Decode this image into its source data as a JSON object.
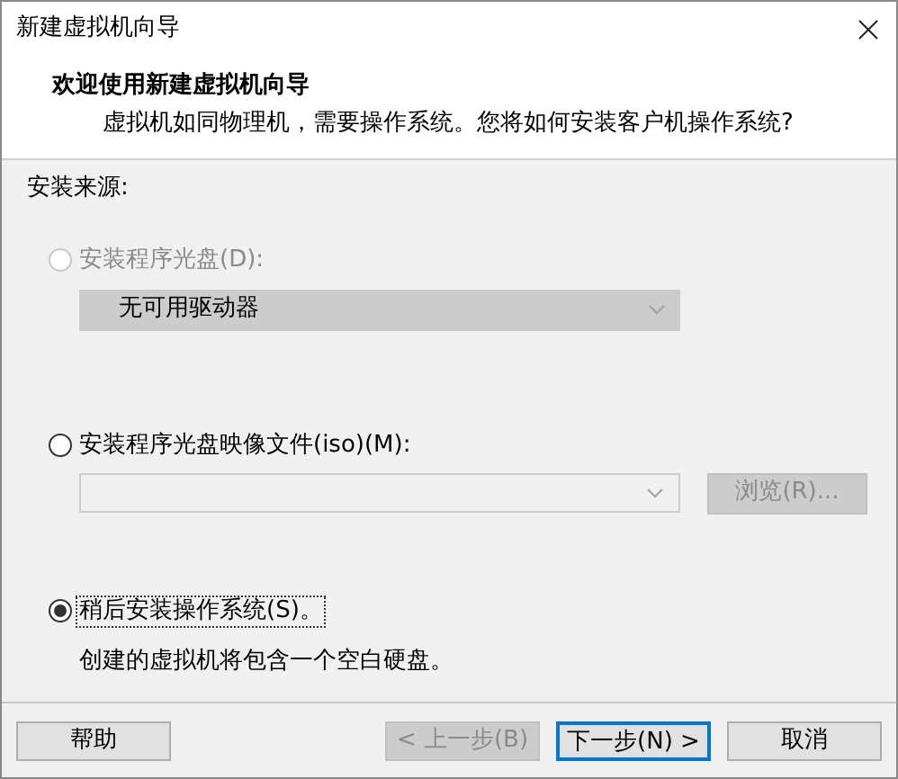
{
  "window": {
    "title": "新建虚拟机向导"
  },
  "header": {
    "title": "欢迎使用新建虚拟机向导",
    "subtitle": "虚拟机如同物理机，需要操作系统。您将如何安装客户机操作系统?"
  },
  "section_label": "安装来源:",
  "options": [
    {
      "kind": "drive",
      "label": "安装程序光盘(D):",
      "selected": false,
      "disabled": true,
      "dropdown": {
        "value": "无可用驱动器",
        "disabled": true
      }
    },
    {
      "kind": "iso",
      "label": "安装程序光盘映像文件(iso)(M):",
      "selected": false,
      "disabled": false,
      "combo": {
        "disabled": true
      },
      "browse": {
        "label": "浏览(R)...",
        "disabled": true
      }
    },
    {
      "kind": "later",
      "label": "稍后安装操作系统(S)。",
      "selected": true,
      "disabled": false,
      "description": "创建的虚拟机将包含一个空白硬盘。"
    }
  ],
  "buttons": [
    {
      "label": "帮助",
      "disabled": false,
      "default": false
    },
    {
      "label": "< 上一步(B)",
      "disabled": true,
      "default": false
    },
    {
      "label": "下一步(N) >",
      "disabled": false,
      "default": true
    },
    {
      "label": "取消",
      "disabled": false,
      "default": false
    }
  ]
}
